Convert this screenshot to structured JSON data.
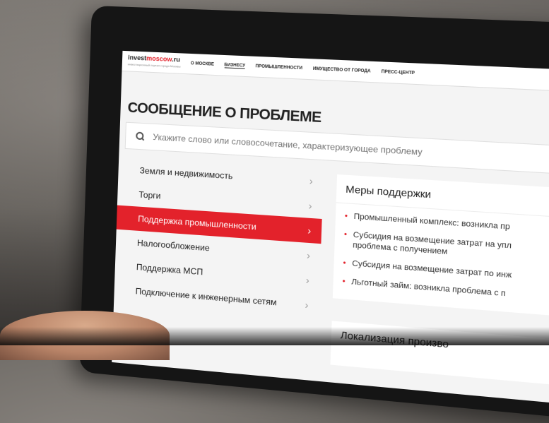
{
  "site": {
    "logo_prefix": "invest",
    "logo_accent": "moscow",
    "logo_suffix": ".ru",
    "logo_sub": "инвестиционный портал города Москвы"
  },
  "nav": {
    "items": [
      {
        "label": "О Москве"
      },
      {
        "label": "Бизнесу"
      },
      {
        "label": "Промышленности"
      },
      {
        "label": "Имущество от города"
      },
      {
        "label": "Пресс-центр"
      }
    ]
  },
  "page": {
    "title": "СООБЩЕНИЕ О ПРОБЛЕМЕ"
  },
  "search": {
    "placeholder": "Укажите слово или словосочетание, характеризующее проблему"
  },
  "menu": {
    "items": [
      {
        "label": "Земля и недвижимость",
        "active": false
      },
      {
        "label": "Торги",
        "active": false
      },
      {
        "label": "Поддержка промышленности",
        "active": true
      },
      {
        "label": "Налогообложение",
        "active": false
      },
      {
        "label": "Поддержка МСП",
        "active": false
      },
      {
        "label": "Подключение к инженерным сетям",
        "active": false
      }
    ]
  },
  "support_panel": {
    "title": "Меры поддержки",
    "items": [
      "Промышленный комплекс: возникла пр",
      "Субсидия на возмещение затрат на упл",
      "проблема с получением",
      "Субсидия на возмещение затрат по инж",
      "Льготный займ: возникла проблема с п"
    ]
  },
  "localization_panel": {
    "title": "Локализация произво"
  },
  "colors": {
    "accent": "#e3222b"
  }
}
